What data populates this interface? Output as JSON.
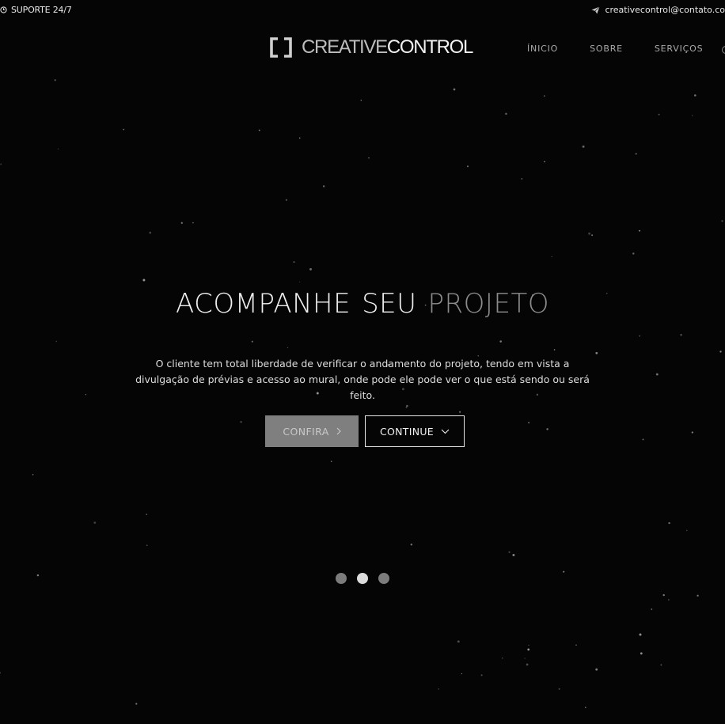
{
  "topbar": {
    "support_label": "SUPORTE 24/7",
    "support_icon": "clock-icon",
    "contact_email": "creativecontrol@contato.co",
    "contact_icon": "paper-plane-icon"
  },
  "logo": {
    "light_text": "CREATIVE",
    "bold_text": "CONTROL",
    "mark_icon": "bracket-logo-icon"
  },
  "nav": {
    "items": [
      {
        "label": "ÍNICIO"
      },
      {
        "label": "SOBRE"
      },
      {
        "label": "SERVIÇOS"
      }
    ]
  },
  "hero": {
    "title_word1": "ACOMPANHE",
    "title_word2": "SEU",
    "title_word3": "PROJETO",
    "description": "O cliente tem total liberdade de verificar o andamento do projeto, tendo em vista a divulgação de prévias e acesso ao mural, onde pode ele pode ver o que está sendo ou será feito.",
    "primary_button": "CONFIRA",
    "secondary_button": "CONTINUE"
  },
  "slider": {
    "dot_count": 3,
    "active_index": 1
  },
  "colors": {
    "background": "#050505",
    "accent_gray": "#7f7f7f",
    "text_light": "#efefef",
    "text_muted": "#8c8c8c"
  }
}
